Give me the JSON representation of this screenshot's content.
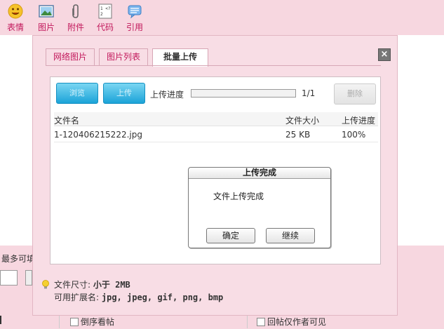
{
  "toolbar": {
    "items": [
      {
        "label": "表情",
        "icon": "smiley-icon"
      },
      {
        "label": "图片",
        "icon": "picture-icon"
      },
      {
        "label": "附件",
        "icon": "paperclip-icon"
      },
      {
        "label": "代码",
        "icon": "code-icon"
      },
      {
        "label": "引用",
        "icon": "quote-icon"
      }
    ]
  },
  "background": {
    "left_text": "最多可填",
    "checkbox1": "倒序看帖",
    "checkbox2": "回帖仅作者可见"
  },
  "dialog": {
    "tabs": [
      "网络图片",
      "图片列表",
      "批量上传"
    ],
    "active_tab": "批量上传",
    "close_label": "×",
    "browse_label": "浏览",
    "upload_label": "上传",
    "progress_label": "上传进度",
    "progress_count": "1/1",
    "progress_fraction": 1.0,
    "delete_label": "删除",
    "table": {
      "headers": [
        "文件名",
        "文件大小",
        "上传进度"
      ],
      "rows": [
        {
          "name": "1-120406215222.jpg",
          "size": "25 KB",
          "progress": "100%"
        }
      ]
    },
    "hint": {
      "size_label": "文件尺寸:",
      "size_value": "小于 2MB",
      "ext_label": "可用扩展名:",
      "ext_value": "jpg, jpeg, gif, png, bmp"
    }
  },
  "modal": {
    "title": "上传完成",
    "message": "文件上传完成",
    "ok_label": "确定",
    "continue_label": "继续"
  },
  "colors": {
    "background_pink": "#f7d7e0",
    "tab_text": "#c2185b",
    "button_blue": "#1ba3d8"
  }
}
